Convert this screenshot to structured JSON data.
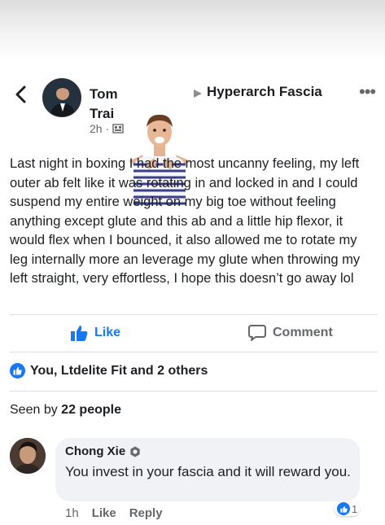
{
  "post": {
    "author_line1": "Tom",
    "author_line2": "Trai",
    "group_name": "Hyperarch Fascia",
    "time": "2h",
    "more": "•••",
    "text": "Last night in boxing I had the most uncanny feeling, my left outer ab felt like it was rotating in and locked in and I could suspend my entire weight on my big toe without feeling anything except glute and this ab and a little hip flexor, it would flex when I bounced, it also allowed me to rotate my leg internally more an leverage my glute when throwing my left straight, very effortless, I hope this doesn’t go away lol"
  },
  "actions": {
    "like": "Like",
    "comment": "Comment"
  },
  "reactions": {
    "summary": "You, Ltdelite Fit and 2 others"
  },
  "seen": {
    "prefix": "Seen by",
    "count": "22 people"
  },
  "comment": {
    "author": "Chong Xie",
    "text": "You invest in your fascia and it will reward you.",
    "time": "1h",
    "like": "Like",
    "reply": "Reply",
    "reaction_count": "1"
  },
  "colors": {
    "accent": "#1877f2",
    "muted": "#65676b",
    "bubble": "#f0f2f5"
  }
}
